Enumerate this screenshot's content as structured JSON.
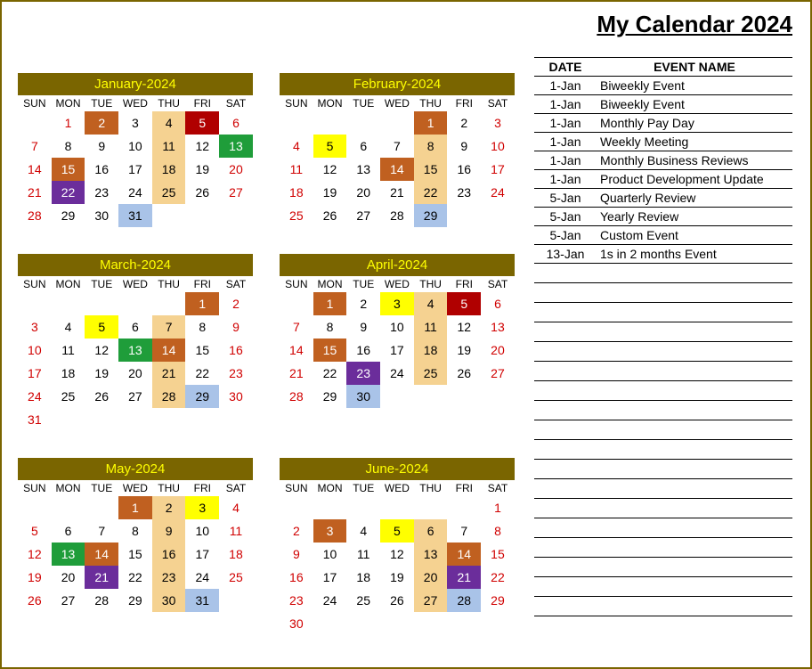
{
  "title": "My Calendar 2024",
  "dow": [
    "SUN",
    "MON",
    "TUE",
    "WED",
    "THU",
    "FRI",
    "SAT"
  ],
  "eventsHeader": {
    "date": "DATE",
    "name": "EVENT NAME"
  },
  "events": [
    {
      "date": "1-Jan",
      "name": "Biweekly Event"
    },
    {
      "date": "1-Jan",
      "name": "Biweekly Event"
    },
    {
      "date": "1-Jan",
      "name": "Monthly Pay Day"
    },
    {
      "date": "1-Jan",
      "name": "Weekly Meeting"
    },
    {
      "date": "1-Jan",
      "name": "Monthly Business Reviews"
    },
    {
      "date": "1-Jan",
      "name": "Product Development Update"
    },
    {
      "date": "5-Jan",
      "name": "Quarterly Review"
    },
    {
      "date": "5-Jan",
      "name": "Yearly Review"
    },
    {
      "date": "5-Jan",
      "name": "Custom Event"
    },
    {
      "date": "13-Jan",
      "name": "1s in 2 months Event"
    }
  ],
  "blankEventLines": 18,
  "months": [
    {
      "label": "January-2024",
      "startDow": 1,
      "days": 31,
      "styles": {
        "1": "red",
        "2": "bg-olive",
        "4": "bg-orange",
        "5": "bg-darkred",
        "6": "red",
        "7": "red",
        "11": "bg-orange",
        "13": "bg-green",
        "14": "red",
        "15": "bg-olive",
        "18": "bg-orange",
        "20": "red",
        "21": "red",
        "22": "bg-purple",
        "25": "bg-orange",
        "27": "red",
        "28": "red",
        "31": "bg-blue"
      }
    },
    {
      "label": "February-2024",
      "startDow": 4,
      "days": 29,
      "styles": {
        "1": "bg-olive",
        "3": "red",
        "4": "red",
        "5": "bg-yellow",
        "8": "bg-orange",
        "10": "red",
        "11": "red",
        "14": "bg-olive",
        "15": "bg-orange",
        "17": "red",
        "18": "red",
        "22": "bg-orange",
        "24": "red",
        "25": "red",
        "29": "bg-blue"
      }
    },
    {
      "label": "March-2024",
      "startDow": 5,
      "days": 31,
      "styles": {
        "1": "bg-olive",
        "2": "red",
        "3": "red",
        "5": "bg-yellow",
        "7": "bg-orange",
        "9": "red",
        "10": "red",
        "13": "bg-green",
        "14": "bg-olive",
        "16": "red",
        "17": "red",
        "21": "bg-orange",
        "23": "red",
        "24": "red",
        "28": "bg-orange",
        "29": "bg-blue",
        "30": "red",
        "31": "red"
      }
    },
    {
      "label": "April-2024",
      "startDow": 1,
      "days": 30,
      "styles": {
        "1": "bg-olive",
        "3": "bg-yellow",
        "4": "bg-orange",
        "5": "bg-darkred",
        "6": "red",
        "7": "red",
        "11": "bg-orange",
        "13": "red",
        "14": "red",
        "15": "bg-olive",
        "18": "bg-orange",
        "20": "red",
        "21": "red",
        "23": "bg-purple",
        "25": "bg-orange",
        "27": "red",
        "28": "red",
        "30": "bg-blue"
      }
    },
    {
      "label": "May-2024",
      "startDow": 3,
      "days": 31,
      "styles": {
        "1": "bg-olive",
        "2": "bg-orange",
        "3": "bg-yellow",
        "4": "red",
        "5": "red",
        "9": "bg-orange",
        "11": "red",
        "12": "red",
        "13": "bg-green",
        "14": "bg-olive",
        "16": "bg-orange",
        "18": "red",
        "19": "red",
        "21": "bg-purple",
        "23": "bg-orange",
        "25": "red",
        "26": "red",
        "30": "bg-orange",
        "31": "bg-blue"
      }
    },
    {
      "label": "June-2024",
      "startDow": 6,
      "days": 30,
      "styles": {
        "1": "red",
        "2": "red",
        "3": "bg-olive",
        "5": "bg-yellow",
        "6": "bg-orange",
        "8": "red",
        "9": "red",
        "13": "bg-orange",
        "14": "bg-olive",
        "15": "red",
        "16": "red",
        "20": "bg-orange",
        "21": "bg-purple",
        "22": "red",
        "23": "red",
        "27": "bg-orange",
        "28": "bg-blue",
        "29": "red",
        "30": "red"
      }
    }
  ]
}
